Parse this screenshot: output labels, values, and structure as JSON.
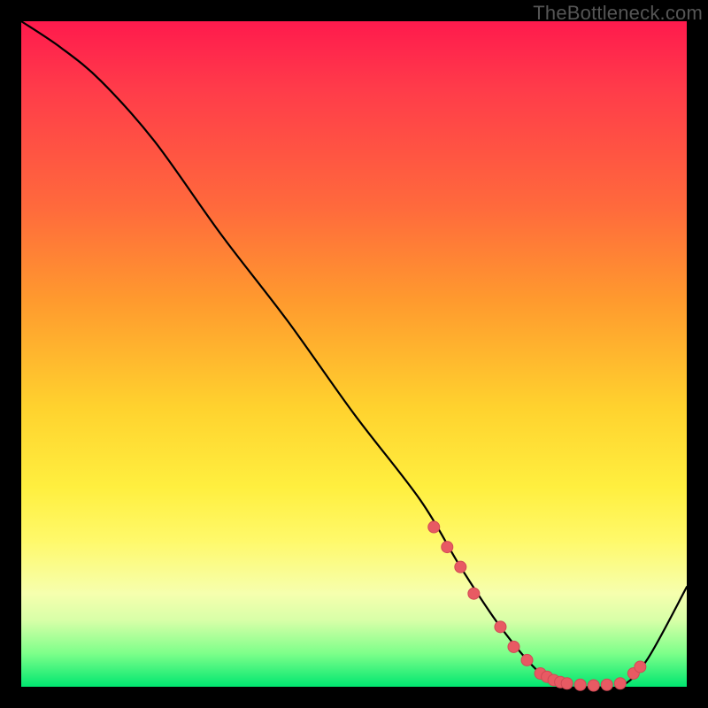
{
  "watermark": "TheBottleneck.com",
  "colors": {
    "background": "#000000",
    "gradient_top": "#ff1a4d",
    "gradient_mid": "#ffd22e",
    "gradient_bottom": "#00e670",
    "curve": "#000000",
    "marker": "#e85a63"
  },
  "chart_data": {
    "type": "line",
    "title": "",
    "xlabel": "",
    "ylabel": "",
    "xlim": [
      0,
      100
    ],
    "ylim": [
      0,
      100
    ],
    "grid": false,
    "x": [
      0,
      6,
      12,
      20,
      30,
      40,
      50,
      60,
      66,
      72,
      78,
      82,
      86,
      90,
      94,
      100
    ],
    "values": [
      100,
      96,
      91,
      82,
      68,
      55,
      41,
      28,
      18,
      9,
      2,
      0,
      0,
      0,
      4,
      15
    ],
    "markers_x": [
      62,
      64,
      66,
      68,
      72,
      74,
      76,
      78,
      79,
      80,
      81,
      82,
      84,
      86,
      88,
      90,
      92,
      93
    ],
    "markers_y": [
      24,
      21,
      18,
      14,
      9,
      6,
      4,
      2,
      1.5,
      1,
      0.7,
      0.5,
      0.3,
      0.2,
      0.3,
      0.5,
      2,
      3
    ],
    "annotations": []
  }
}
